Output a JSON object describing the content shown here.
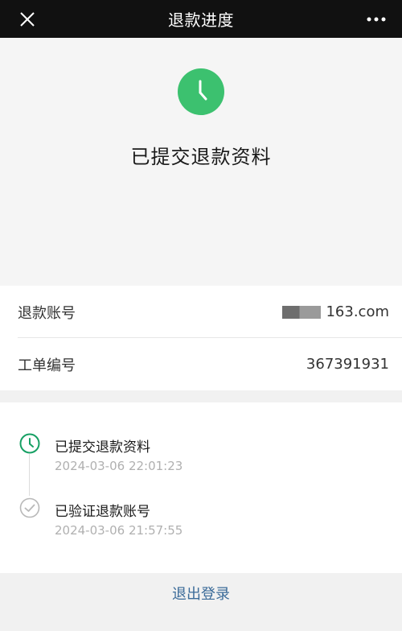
{
  "header": {
    "title": "退款进度"
  },
  "status": {
    "title": "已提交退款资料",
    "icon": "clock-icon",
    "accent_color": "#3cc16f"
  },
  "info": {
    "rows": [
      {
        "label": "退款账号",
        "value": "163.com"
      },
      {
        "label": "工单编号",
        "value": "367391931"
      }
    ]
  },
  "timeline": {
    "items": [
      {
        "title": "已提交退款资料",
        "time": "2024-03-06 22:01:23",
        "icon": "clock-icon",
        "color": "#17a064"
      },
      {
        "title": "已验证退款账号",
        "time": "2024-03-06 21:57:55",
        "icon": "check-circle-icon",
        "color": "#b8b8b8"
      }
    ]
  },
  "footer": {
    "logout_label": "退出登录"
  }
}
